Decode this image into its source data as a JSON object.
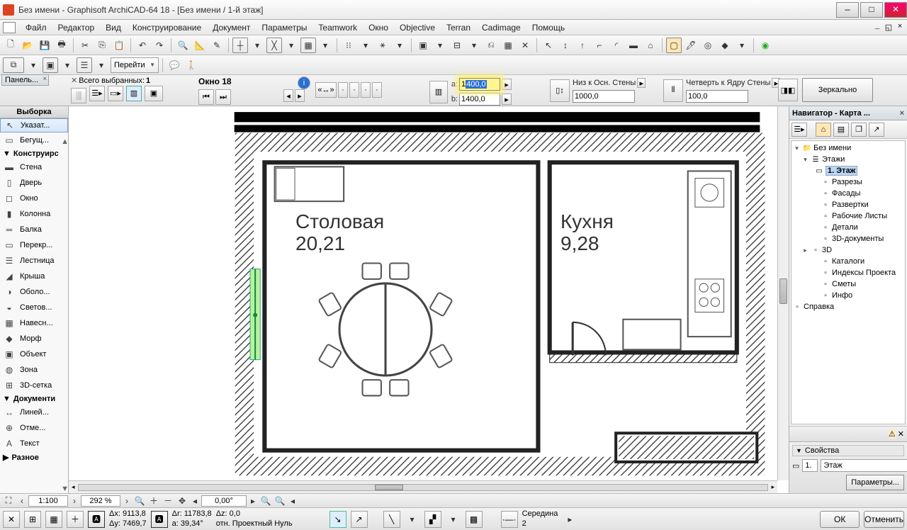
{
  "title": "Без имени - Graphisoft ArchiCAD-64 18 - [Без имени / 1-й этаж]",
  "menu": [
    "Файл",
    "Редактор",
    "Вид",
    "Конструирование",
    "Документ",
    "Параметры",
    "Teamwork",
    "Окно",
    "Objective",
    "Terran",
    "Cadimage",
    "Помощь"
  ],
  "nav2": {
    "goto": "Перейти"
  },
  "panel_tab": "Панель...",
  "selection_label": "Всего выбранных:",
  "selection_count": "1",
  "element_name": "Окно 18",
  "dims": {
    "a_label": "a:",
    "a_value": "1400,0",
    "b_label": "b:",
    "b_value": "1400,0",
    "anchor1_label": "Низ к Осн. Стены",
    "anchor1_value": "1000,0",
    "anchor2_label": "Четверть к Ядру Стены",
    "anchor2_value": "100,0",
    "mirror": "Зеркально"
  },
  "toolbox": {
    "title": "Выборка",
    "active": "Указат...",
    "marquee": "Бегущ...",
    "section1": "Конструирс",
    "tools1": [
      "Стена",
      "Дверь",
      "Окно",
      "Колонна",
      "Балка",
      "Перекр...",
      "Лестница",
      "Крыша",
      "Оболо...",
      "Светов...",
      "Навесн...",
      "Морф",
      "Объект",
      "Зона",
      "3D-сетка"
    ],
    "section2": "Документи",
    "tools2": [
      "Линей...",
      "Отме...",
      "Текст"
    ],
    "more": "Разное"
  },
  "rooms": {
    "dining": {
      "name": "Столовая",
      "area": "20,21"
    },
    "kitchen": {
      "name": "Кухня",
      "area": "9,28"
    }
  },
  "navigator": {
    "title": "Навигатор - Карта ...",
    "root": "Без имени",
    "floors": "Этажи",
    "current_floor": "1. Этаж",
    "nodes": [
      "Разрезы",
      "Фасады",
      "Развертки",
      "Рабочие Листы",
      "Детали",
      "3D-документы",
      "3D",
      "Каталоги",
      "Индексы Проекта",
      "Сметы",
      "Инфо",
      "Справка"
    ],
    "props": "Свойства",
    "floor_label": "Этаж",
    "id_field": "1.",
    "params_btn": "Параметры..."
  },
  "viewbar": {
    "scale": "1:100",
    "zoom": "292 %",
    "angle": "0,00°"
  },
  "coords": {
    "dx": "Δx: 9113,8",
    "dy": "Δy: 7469,7",
    "dr": "Δr: 11783,8",
    "da": "a:   39,34°",
    "dz": "Δz: 0,0",
    "origin": "отн. Проектный Нуль",
    "snap": "Середина",
    "snap_n": "2",
    "ok": "ОК",
    "cancel": "Отменить"
  }
}
